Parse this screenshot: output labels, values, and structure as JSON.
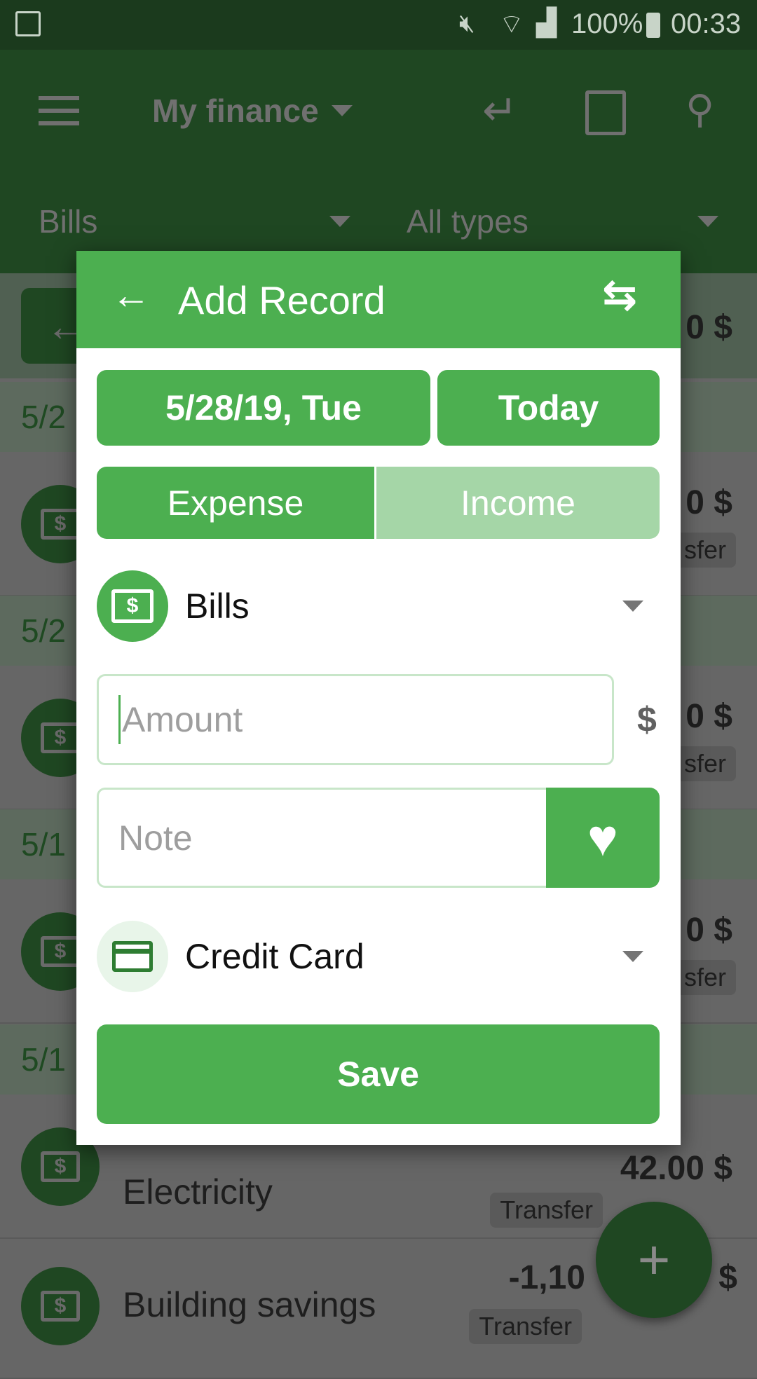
{
  "status_bar": {
    "battery": "100%",
    "time": "00:33",
    "icons": [
      "gallery-icon",
      "mute-icon",
      "wifi-icon",
      "signal-icon",
      "battery-icon"
    ]
  },
  "app_bar": {
    "title": "My finance",
    "category_filter": "Bills",
    "type_filter": "All types",
    "icons": [
      "menu-icon",
      "return-icon",
      "add-budget-icon",
      "search-icon"
    ]
  },
  "background_list": {
    "header_amount": "0 $",
    "date_headers": [
      "5/2",
      "5/2",
      "5/1",
      "5/1"
    ],
    "rows": [
      {
        "name": "",
        "amount": "0 $",
        "badge": "sfer"
      },
      {
        "name": "",
        "amount": "0 $",
        "badge": "sfer"
      },
      {
        "name": "",
        "amount": "0 $",
        "badge": "sfer"
      },
      {
        "name": "Electricity",
        "amount": "42.00 $",
        "badge": "Transfer"
      },
      {
        "name": "Building savings",
        "amount": "-1,10",
        "amount_tail": "$",
        "badge": "Transfer"
      }
    ],
    "fab": "+"
  },
  "dialog": {
    "title": "Add Record",
    "date": "5/28/19, Tue",
    "today": "Today",
    "tabs": [
      {
        "label": "Expense",
        "active": true
      },
      {
        "label": "Income",
        "active": false
      }
    ],
    "category": "Bills",
    "amount_placeholder": "Amount",
    "currency": "$",
    "note_placeholder": "Note",
    "account": "Credit Card",
    "save": "Save"
  },
  "colors": {
    "primary": "#4caf50",
    "primary_dark": "#388e3c",
    "inactive_tab": "#a5d6a7"
  }
}
